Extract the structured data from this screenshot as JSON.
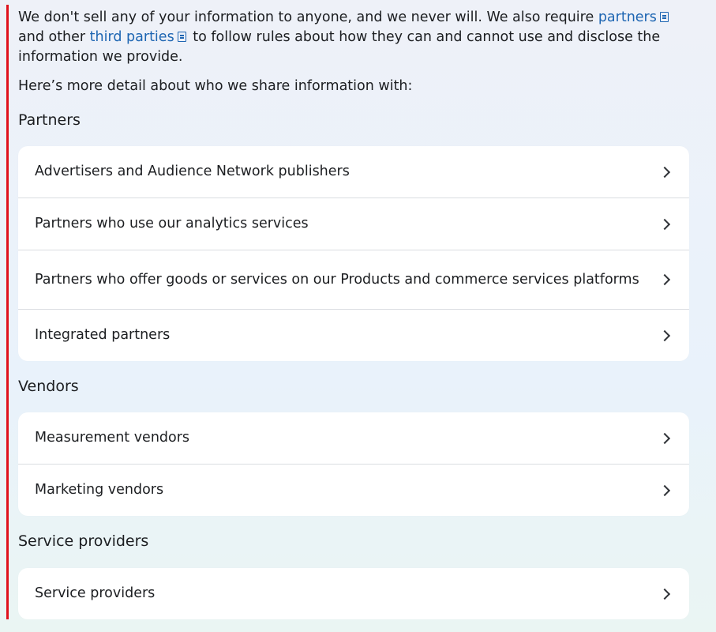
{
  "intro": {
    "text_1": "We don't sell any of your information to anyone, and we never will. We also require ",
    "link_partners": "partners",
    "text_2": " and other ",
    "link_third_parties": "third parties",
    "text_3": " to follow rules about how they can and cannot use and disclose the information we provide."
  },
  "detail_text": "Here’s more detail about who we share information with:",
  "sections": {
    "partners": {
      "heading": "Partners",
      "items": [
        {
          "label": "Advertisers and Audience Network publishers"
        },
        {
          "label": "Partners who use our analytics services"
        },
        {
          "label": "Partners who offer goods or services on our Products and commerce services platforms"
        },
        {
          "label": "Integrated partners"
        }
      ]
    },
    "vendors": {
      "heading": "Vendors",
      "items": [
        {
          "label": "Measurement vendors"
        },
        {
          "label": "Marketing vendors"
        }
      ]
    },
    "service_providers": {
      "heading": "Service providers",
      "items": [
        {
          "label": "Service providers"
        }
      ]
    }
  },
  "icons": {
    "link_icon": "document-icon",
    "row_icon": "chevron-right-icon"
  },
  "colors": {
    "link": "#1d65b2",
    "left_rule": "#e0111c",
    "card": "#ffffff",
    "divider": "#dadde1"
  }
}
